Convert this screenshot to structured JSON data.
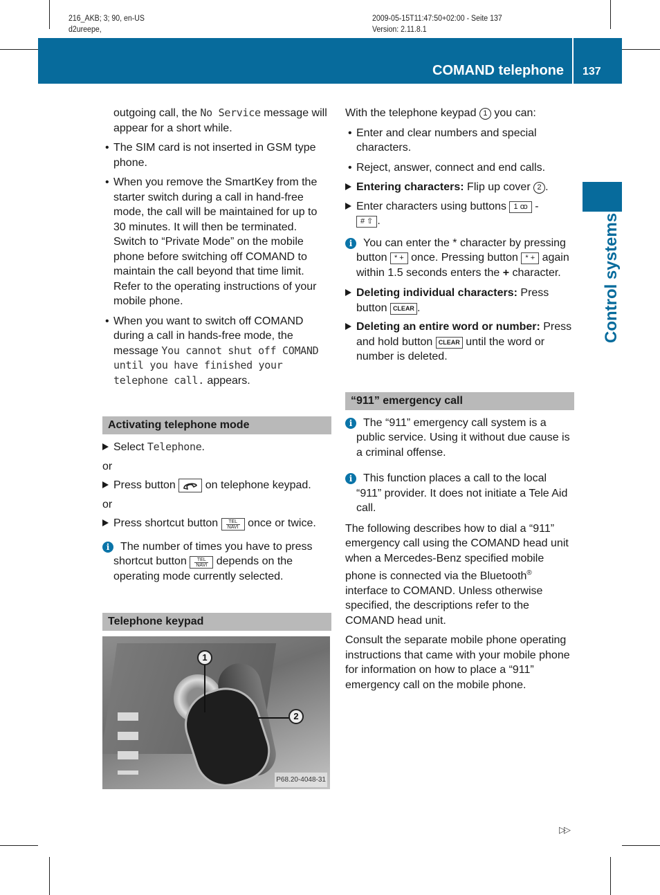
{
  "meta": {
    "left_line1": "216_AKB; 3; 90, en-US",
    "left_line2": "d2ureepe,",
    "right_line1": "2009-05-15T11:47:50+02:00 - Seite 137",
    "right_line2": "Version: 2.11.8.1"
  },
  "header": {
    "title": "COMAND telephone",
    "page_number": "137",
    "color": "#076b9c"
  },
  "side_tab": {
    "label": "Control systems"
  },
  "left_column": {
    "intro": {
      "pre": "outgoing call, the ",
      "mono": "No Service",
      "post": " message will appear for a short while."
    },
    "bullets": [
      {
        "text": "The SIM card is not inserted in GSM type phone."
      },
      {
        "text": "When you remove the SmartKey from the starter switch during a call in hand-free mode, the call will be maintained for up to 30 minutes. It will then be terminated. Switch to “Private Mode” on the mobile phone before switching off COMAND to maintain the call beyond that time limit. Refer to the operating instructions of your mobile phone."
      },
      {
        "pre": "When you want to switch off COMAND during a call in hands-free mode, the message ",
        "mono": "You cannot shut off COMAND until you have finished your telephone call.",
        "post": " appears."
      }
    ],
    "section_activating": {
      "heading": "Activating telephone mode",
      "step1_pre": "Select ",
      "step1_mono": "Telephone",
      "step1_post": ".",
      "or": "or",
      "step2_pre": "Press button ",
      "step2_post": " on telephone keypad.",
      "step3_pre": "Press shortcut button ",
      "step3_post": " once or twice.",
      "key_tel_top": "TEL",
      "key_tel_bottom": "NAVI",
      "info_pre": "The number of times you have to press shortcut button ",
      "info_post": " depends on the operating mode currently selected."
    },
    "section_keypad": {
      "heading": "Telephone keypad",
      "figure": {
        "callout_1": "1",
        "callout_2": "2",
        "reference": "P68.20-4048-31"
      }
    }
  },
  "right_column": {
    "intro_pre": "With the telephone keypad ",
    "intro_circ": "1",
    "intro_post": " you can:",
    "bullets": [
      "Enter and clear numbers and special characters.",
      "Reject, answer, connect and end calls."
    ],
    "step_entering": {
      "bold": "Entering characters:",
      "pre": " Flip up cover ",
      "circ": "2",
      "post": "."
    },
    "step_enter_buttons": {
      "pre": "Enter characters using buttons ",
      "key_from": "1 ꝏ",
      "dash": " -",
      "key_to": "# ⇧",
      "post": "."
    },
    "info_star": {
      "pre": "You can enter the * character by pressing button ",
      "key": "* +",
      "mid": " once. Pressing button ",
      "post": " again within 1.5 seconds enters the ",
      "plus": "+",
      "end": " character."
    },
    "step_delete_char": {
      "bold": "Deleting individual characters:",
      "pre": " Press button ",
      "key": "CLEAR",
      "post": "."
    },
    "step_delete_word": {
      "bold": "Deleting an entire word or number:",
      "pre": " Press and hold button ",
      "key": "CLEAR",
      "post": " until the word or number is deleted."
    },
    "section_911": {
      "heading": "“911” emergency call",
      "info1": "The “911” emergency call system is a public service. Using it without due cause is a criminal offense.",
      "info2": "This function places a call to the local “911” provider. It does not initiate a Tele Aid call.",
      "para1_pre": "The following describes how to dial a “911” emergency call using the COMAND head unit when a Mercedes-Benz specified mobile phone is connected via the Bluetooth",
      "para1_reg": "®",
      "para1_post": " interface to COMAND. Unless otherwise specified, the descriptions refer to the COMAND head unit.",
      "para2": "Consult the separate mobile phone operating instructions that came with your mobile phone for information on how to place a “911” emergency call on the mobile phone."
    }
  },
  "footer": {
    "continue_glyph": "▷▷"
  },
  "icons": {
    "info": "i"
  }
}
